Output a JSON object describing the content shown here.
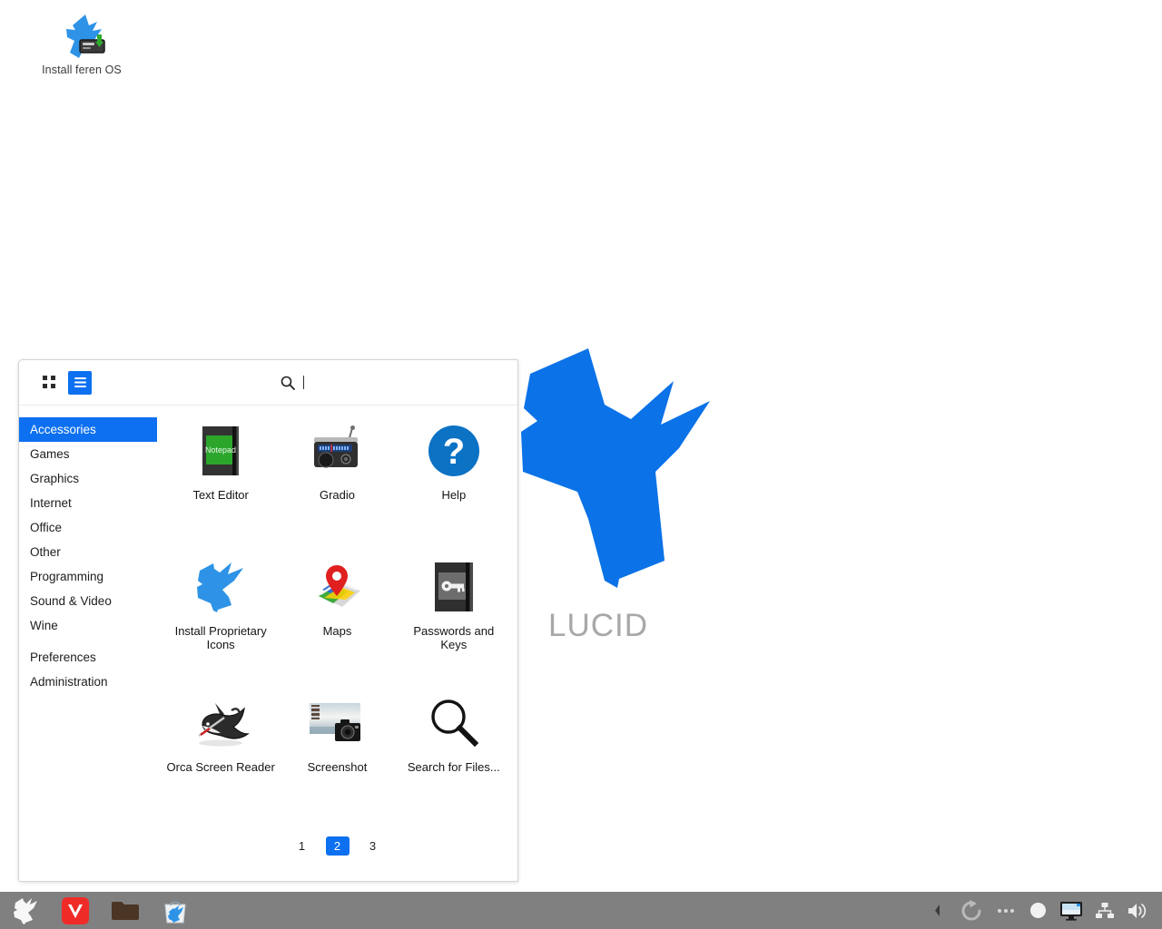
{
  "desktop": {
    "icons": [
      {
        "label": "Install feren OS",
        "icon": "feren-install-icon"
      }
    ],
    "branding": {
      "text": "LUCID",
      "mark": "feren-bird-logo",
      "mark_color": "#0b72e7",
      "text_color": "#a8a8a8"
    },
    "background_color": "#ffffff"
  },
  "menu": {
    "view_toggles": [
      {
        "name": "grid-view",
        "icon": "grid-view-icon",
        "active": false
      },
      {
        "name": "list-view",
        "icon": "list-view-icon",
        "active": true
      }
    ],
    "search": {
      "icon": "search-icon",
      "value": "",
      "placeholder": ""
    },
    "categories": [
      {
        "label": "Accessories",
        "selected": true
      },
      {
        "label": "Games",
        "selected": false
      },
      {
        "label": "Graphics",
        "selected": false
      },
      {
        "label": "Internet",
        "selected": false
      },
      {
        "label": "Office",
        "selected": false
      },
      {
        "label": "Other",
        "selected": false
      },
      {
        "label": "Programming",
        "selected": false
      },
      {
        "label": "Sound & Video",
        "selected": false
      },
      {
        "label": "Wine",
        "selected": false
      },
      {
        "label": "Preferences",
        "selected": false
      },
      {
        "label": "Administration",
        "selected": false
      }
    ],
    "apps": [
      {
        "label": "Text Editor",
        "icon": "text-editor-icon"
      },
      {
        "label": "Gradio",
        "icon": "gradio-radio-icon"
      },
      {
        "label": "Help",
        "icon": "help-question-icon"
      },
      {
        "label": "Install Proprietary Icons",
        "icon": "feren-bird-icon"
      },
      {
        "label": "Maps",
        "icon": "maps-pin-icon"
      },
      {
        "label": "Passwords and Keys",
        "icon": "passwords-keys-icon"
      },
      {
        "label": "Orca Screen Reader",
        "icon": "orca-whale-icon"
      },
      {
        "label": "Screenshot",
        "icon": "screenshot-camera-icon"
      },
      {
        "label": "Search for Files...",
        "icon": "search-files-icon"
      }
    ],
    "pagination": {
      "pages": [
        "1",
        "2",
        "3"
      ],
      "current": "2"
    },
    "accent_color": "#0d70f0"
  },
  "taskbar": {
    "background_color": "#808080",
    "launchers": [
      {
        "name": "menu-button",
        "icon": "feren-menu-icon"
      },
      {
        "name": "vivaldi-browser",
        "icon": "vivaldi-icon"
      },
      {
        "name": "file-manager",
        "icon": "folder-icon"
      },
      {
        "name": "software-store",
        "icon": "software-store-icon"
      }
    ],
    "tray": [
      {
        "name": "tray-expand",
        "icon": "chevron-left-icon"
      },
      {
        "name": "update-manager",
        "icon": "refresh-icon"
      },
      {
        "name": "tray-more",
        "icon": "three-dots-icon"
      },
      {
        "name": "tray-indicator",
        "icon": "circle-icon"
      },
      {
        "name": "display-settings",
        "icon": "monitor-icon"
      },
      {
        "name": "network-status",
        "icon": "network-icon"
      },
      {
        "name": "volume-control",
        "icon": "speaker-icon"
      }
    ]
  }
}
